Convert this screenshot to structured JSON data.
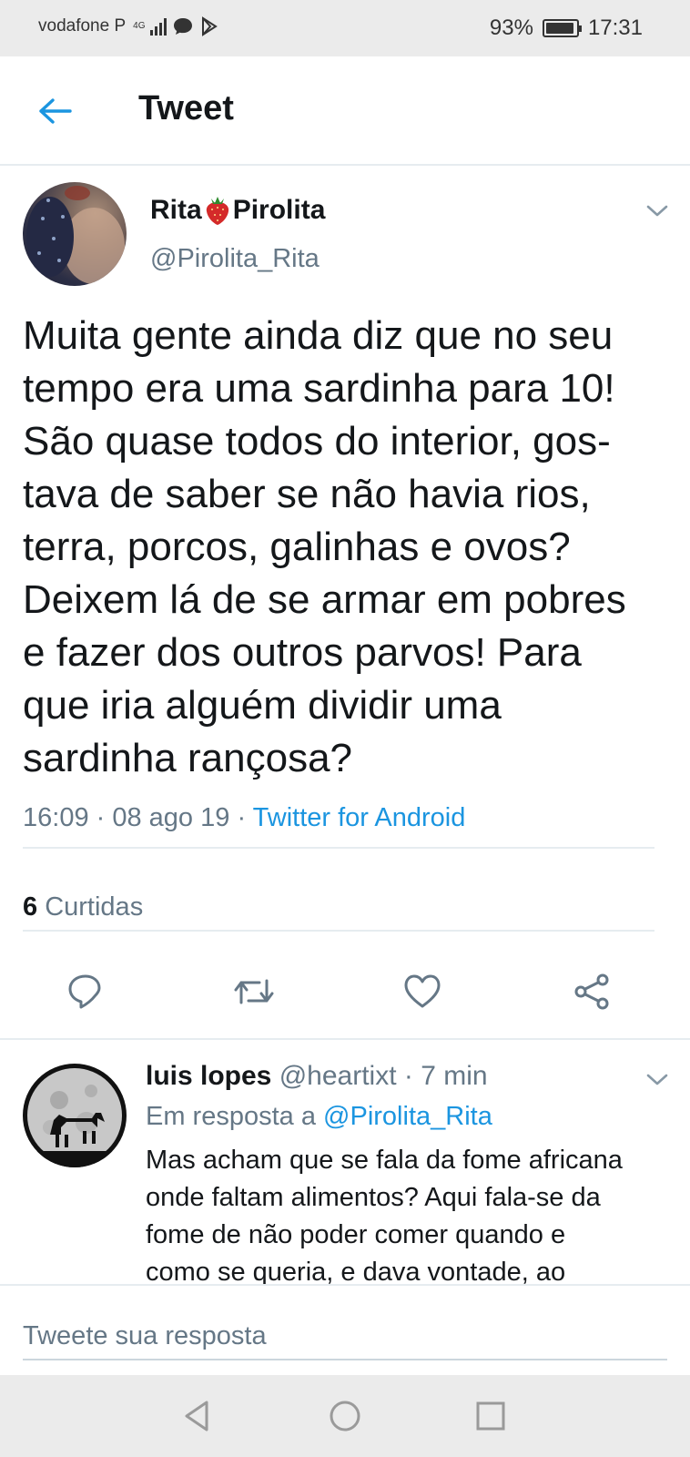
{
  "status_bar": {
    "carrier": "vodafone P",
    "network": "4G",
    "battery": "93%",
    "battery_level": 0.93,
    "time": "17:31"
  },
  "header": {
    "title": "Tweet"
  },
  "tweet": {
    "author_name_part1": "Rita",
    "author_name_part2": "Pirolita",
    "author_handle": "@Pirolita_Rita",
    "text": "Muita gente ainda diz que no seu\ntempo era uma sardinha para 10!\nSão quase todos do interior, gos-\ntava de saber se não havia rios,\nterra, porcos, galinhas e ovos?\nDeixem lá de se armar em pobres\ne fazer dos outros parvos! Para\nque iria alguém dividir uma\nsardinha rançosa?",
    "time": "16:09",
    "date": "08 ago 19",
    "source": "Twitter for Android",
    "likes_count": "6",
    "likes_label": "Curtidas"
  },
  "icons": {
    "back": "arrow-left-icon",
    "reply": "speech-bubble-icon",
    "retweet": "retweet-icon",
    "like": "heart-icon",
    "share": "share-icon",
    "menu": "chevron-down-icon"
  },
  "reply": {
    "author_name": "luis lopes",
    "author_handle": "@heartixt",
    "age": "7 min",
    "in_reply_prefix": "Em resposta a",
    "in_reply_mention": "@Pirolita_Rita",
    "text": "Mas acham que se fala da fome africana\nonde faltam alimentos? Aqui fala-se da\nfome de não poder comer quando e\ncomo se queria, e dava vontade,  ao"
  },
  "compose": {
    "placeholder": "Tweete sua resposta"
  },
  "colors": {
    "accent": "#1b95e0",
    "secondary_text": "#657786",
    "primary_text": "#14171a",
    "divider": "#e6ecf0"
  }
}
